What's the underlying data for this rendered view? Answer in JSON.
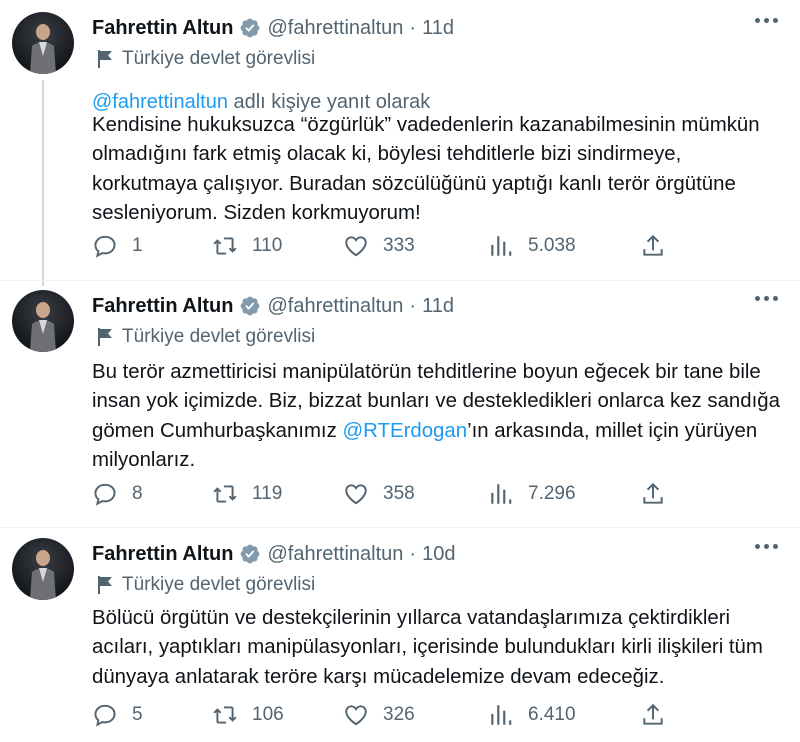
{
  "tweets": [
    {
      "name": "Fahrettin Altun",
      "handle": "@fahrettinaltun",
      "dot": "·",
      "time": "11d",
      "label": "Türkiye devlet görevlisi",
      "reply_mention": "@fahrettinaltun",
      "reply_suffix": " adlı kişiye yanıt olarak",
      "text_parts": [
        "Kendisine hukuksuzca “özgürlük” vadedenlerin kazanabilmesinin mümkün olmadığını fark etmiş olacak ki, böylesi tehditlerle bizi sindirmeye, korkutmaya çalışıyor. Buradan sözcülüğünü yaptığı kanlı terör örgütüne sesleniyorum. Sizden korkmuyorum!"
      ],
      "replies": "1",
      "retweets": "110",
      "likes": "333",
      "views": "5.038"
    },
    {
      "name": "Fahrettin Altun",
      "handle": "@fahrettinaltun",
      "dot": "·",
      "time": "11d",
      "label": "Türkiye devlet görevlisi",
      "text_before": "Bu terör azmettiricisi manipülatörün tehditlerine boyun eğecek bir tane bile insan yok içimizde. Biz, bizzat bunları ve destekledikleri onlarca kez sandığa gömen Cumhurbaşkanımız ",
      "text_mention": "@RTErdogan",
      "text_after": "’ın arkasında, millet için yürüyen milyonlarız.",
      "replies": "8",
      "retweets": "119",
      "likes": "358",
      "views": "7.296"
    },
    {
      "name": "Fahrettin Altun",
      "handle": "@fahrettinaltun",
      "dot": "·",
      "time": "10d",
      "label": "Türkiye devlet görevlisi",
      "text": "Bölücü örgütün ve destekçilerinin yıllarca vatandaşlarımıza çektirdikleri acıları, yaptıkları manipülasyonları, içerisinde bulundukları kirli ilişkileri tüm dünyaya anlatarak teröre karşı mücadelemize devam edeceğiz.",
      "replies": "5",
      "retweets": "106",
      "likes": "326",
      "views": "6.410"
    }
  ],
  "colors": {
    "text": "#0f1419",
    "secondary": "#536471",
    "link": "#1d9bf0",
    "verified": "#829aab"
  },
  "icons": [
    "verified-badge-icon",
    "flag-icon",
    "reply-icon",
    "retweet-icon",
    "like-icon",
    "views-icon",
    "share-icon",
    "more-icon"
  ]
}
